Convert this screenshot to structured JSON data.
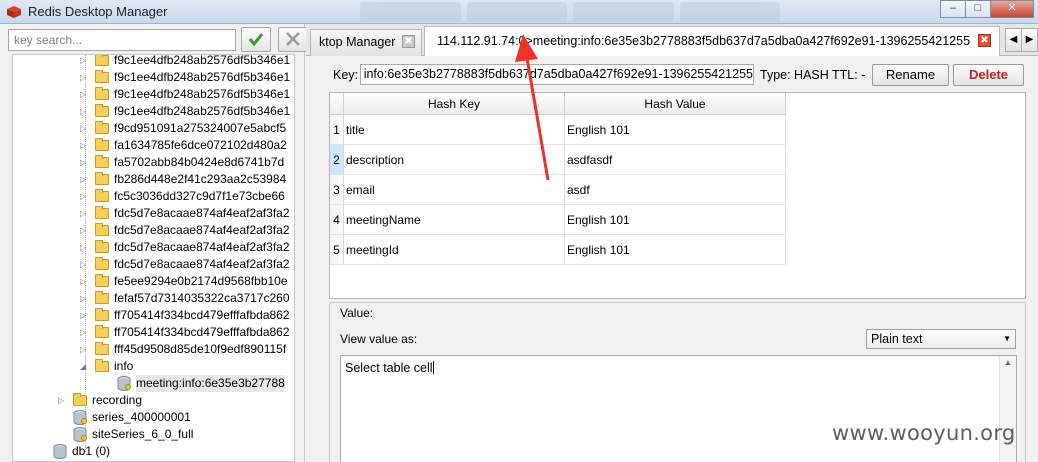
{
  "window": {
    "title": "Redis Desktop Manager",
    "minimize_glyph": "–",
    "maximize_glyph": "□",
    "close_glyph": "✕"
  },
  "search": {
    "placeholder": "key search...",
    "apply_glyph": "✔",
    "clear_glyph": "✖"
  },
  "tree": {
    "key_folders": [
      "f9c1ee4dfb248ab2576df5b346e1",
      "f9c1ee4dfb248ab2576df5b346e1",
      "f9c1ee4dfb248ab2576df5b346e1",
      "f9c1ee4dfb248ab2576df5b346e1",
      "f9cd951091a275324007e5abcf5",
      "fa1634785fe6dce072102d480a2",
      "fa5702abb84b0424e8d6741b7d",
      "fb286d448e2f41c293aa2c53984",
      "fc5c3036dd327c9d7f1e73cbe66",
      "fdc5d7e8acaae874af4eaf2af3fa2",
      "fdc5d7e8acaae874af4eaf2af3fa2",
      "fdc5d7e8acaae874af4eaf2af3fa2",
      "fdc5d7e8acaae874af4eaf2af3fa2",
      "fe5ee9294e0b2174d9568fbb10e",
      "fefaf57d7314035322ca3717c260",
      "ff705414f334bcd479efffafbda862",
      "ff705414f334bcd479efffafbda862",
      "fff45d9508d85de10f9edf890115f"
    ],
    "info_folder": "info",
    "selected_key": "meeting:info:6e35e3b27788",
    "recording_folder": "recording",
    "series_key": "series_400000001",
    "site_series_key": "siteSeries_6_0_full",
    "db1_label": "db1 (0)"
  },
  "tabs": [
    {
      "label": "ktop Manager",
      "close_glyph": "✖"
    },
    {
      "label": "114.112.91.74:0>meeting:info:6e35e3b2778883f5db637d7a5dba0a427f692e91-1396255421255",
      "close_glyph": "✖"
    }
  ],
  "tab_scroll": {
    "left": "◀",
    "right": "▶"
  },
  "key_bar": {
    "key_label": "Key:",
    "key_value": "info:6e35e3b2778883f5db637d7a5dba0a427f692e91-1396255421255",
    "type_ttl": "Type: HASH  TTL: -",
    "rename_label": "Rename",
    "delete_label": "Delete"
  },
  "hash_table": {
    "columns": [
      "Hash Key",
      "Hash Value"
    ],
    "rows": [
      {
        "num": "1",
        "key": "title",
        "value": "English 101"
      },
      {
        "num": "2",
        "key": "description",
        "value": "asdfasdf"
      },
      {
        "num": "3",
        "key": "email",
        "value": "asdf"
      },
      {
        "num": "4",
        "key": "meetingName",
        "value": "English 101"
      },
      {
        "num": "5",
        "key": "meetingId",
        "value": "English 101"
      }
    ]
  },
  "value_panel": {
    "title": "Value:",
    "view_as_label": "View value as:",
    "format_selected": "Plain text",
    "text": "Select table cell"
  },
  "colors": {
    "annotation_arrow": "#e8342a",
    "delete_text": "#c8201c",
    "folder": "#f6cf5a"
  },
  "watermark": "www.wooyun.org"
}
